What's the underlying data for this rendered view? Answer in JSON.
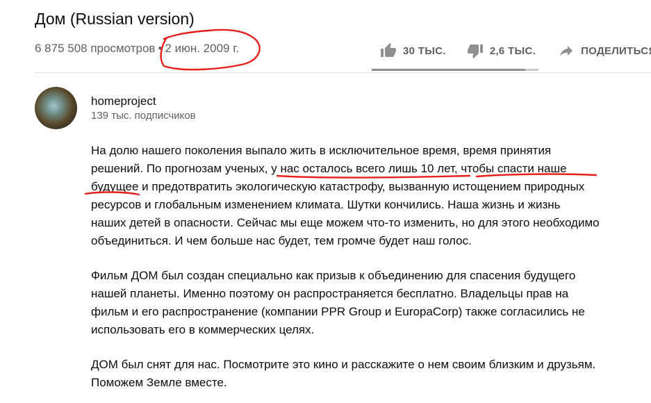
{
  "video": {
    "title": "Дом (Russian version)",
    "views": "6 875 508 просмотров",
    "separator": "•",
    "date": "2 июн. 2009 г."
  },
  "actions": {
    "like_count": "30 ТЫС.",
    "dislike_count": "2,6 ТЫС.",
    "share_label": "ПОДЕЛИТЬСЯ",
    "like_icon": "thumbs-up-icon",
    "dislike_icon": "thumbs-down-icon",
    "share_icon": "share-arrow-icon",
    "like_ratio": 0.92
  },
  "channel": {
    "name": "homeproject",
    "subscribers": "139 тыс. подписчиков"
  },
  "description": {
    "p1": [
      "На долю нашего поколения выпало жить в исключительное время, время принятия",
      "решений. По прогнозам ученых, у нас осталось всего лишь 10 лет, чтобы спасти наше",
      "будущее и предотвратить экологическую катастрофу, вызванную истощением природных",
      "ресурсов и глобальным изменением климата. Шутки кончились. Наша жизнь и жизнь",
      "наших детей в опасности. Сейчас мы еще можем что-то изменить, но для этого необходимо",
      "объединиться. И чем больше нас будет, тем громче будет наш голос."
    ],
    "p2": [
      "Фильм ДОМ был создан специально как призыв к объединению для спасения будущего",
      "нашей планеты. Именно поэтому он распространяется бесплатно. Владельцы прав на",
      "фильм и его распространение (компании PPR Group и EuropaCorp) также согласились не",
      "использовать его в коммерческих целях."
    ],
    "p3": [
      " ДОМ был снят для нас. Посмотрите это кино и расскажите о нем своим близким и друзьям.",
      "Поможем Земле вместе."
    ]
  },
  "colors": {
    "annotation": "#e8201b",
    "muted_text": "#606060",
    "icon": "#909090"
  }
}
